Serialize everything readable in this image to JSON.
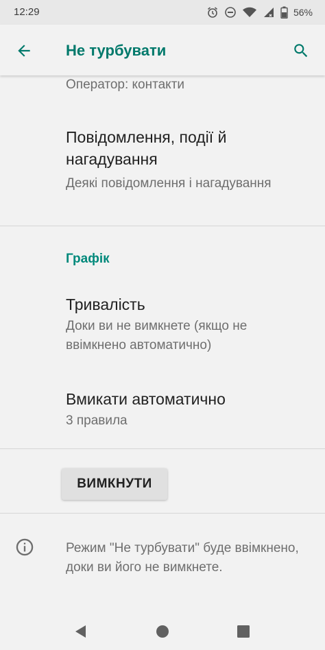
{
  "status_bar": {
    "time": "12:29",
    "battery_percent": "56%",
    "icons": [
      "alarm-icon",
      "do-not-disturb-icon",
      "wifi-icon",
      "signal-icon",
      "battery-icon"
    ]
  },
  "app_bar": {
    "title": "Не турбувати",
    "back_icon": "arrow-back-icon",
    "search_icon": "search-icon"
  },
  "settings": {
    "operator_text": "Оператор: контакти",
    "notifications": {
      "title": "Повідомлення, події й нагадування",
      "summary": "Деякі повідомлення і нагадування"
    },
    "schedule_header": "Графік",
    "duration": {
      "title": "Тривалість",
      "summary": "Доки ви не вимкнете (якщо не ввімкнено автоматично)"
    },
    "auto_on": {
      "title": "Вмикати автоматично",
      "summary": "3 правила"
    },
    "off_button": "ВИМКНУТИ",
    "info_text": "Режим \"Не турбувати\" буде ввімкнено, доки ви його не вимкнете."
  },
  "nav_bar": {
    "icons": [
      "back-triangle-icon",
      "home-circle-icon",
      "recents-square-icon"
    ]
  },
  "colors": {
    "accent": "#00796b",
    "background": "#f2f2f2",
    "divider": "#d6d6d6"
  }
}
